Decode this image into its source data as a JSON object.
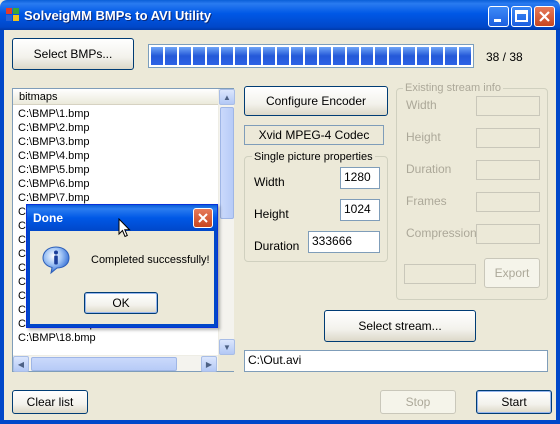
{
  "window": {
    "title": "SolveigMM BMPs to AVI Utility",
    "minimize_icon": "minimize-icon",
    "maximize_icon": "maximize-icon",
    "close_icon": "close-icon"
  },
  "toolbar": {
    "select_bmps_label": "Select BMPs...",
    "progress_count": "38 / 38",
    "progress_fraction": 1.0
  },
  "list": {
    "header": "bitmaps",
    "items": [
      "C:\\BMP\\1.bmp",
      "C:\\BMP\\2.bmp",
      "C:\\BMP\\3.bmp",
      "C:\\BMP\\4.bmp",
      "C:\\BMP\\5.bmp",
      "C:\\BMP\\6.bmp",
      "C:\\BMP\\7.bmp",
      "C:",
      "C:",
      "C:",
      "C:",
      "C:",
      "C:",
      "C:",
      "C:",
      "C:\\BMP\\17.bmp",
      "C:\\BMP\\18.bmp"
    ]
  },
  "encoder": {
    "configure_label": "Configure Encoder",
    "codec_name": "Xvid MPEG-4 Codec"
  },
  "single_picture": {
    "title": "Single picture properties",
    "width_label": "Width",
    "width_value": "1280",
    "height_label": "Height",
    "height_value": "1024",
    "duration_label": "Duration",
    "duration_value": "333666"
  },
  "stream_info": {
    "title": "Existing stream info",
    "width_label": "Width",
    "height_label": "Height",
    "duration_label": "Duration",
    "frames_label": "Frames",
    "compression_label": "Compression",
    "export_label": "Export"
  },
  "select_stream_label": "Select stream...",
  "output_path": "C:\\Out.avi",
  "bottom": {
    "clear_list_label": "Clear list",
    "stop_label": "Stop",
    "start_label": "Start"
  },
  "dialog": {
    "title": "Done",
    "message": "Completed successfully!",
    "ok_label": "OK",
    "icon": "info-icon",
    "close_icon": "close-icon"
  },
  "colors": {
    "titlebar": "#0058e6",
    "progress": "#2458d8",
    "background": "#ece9d8"
  }
}
